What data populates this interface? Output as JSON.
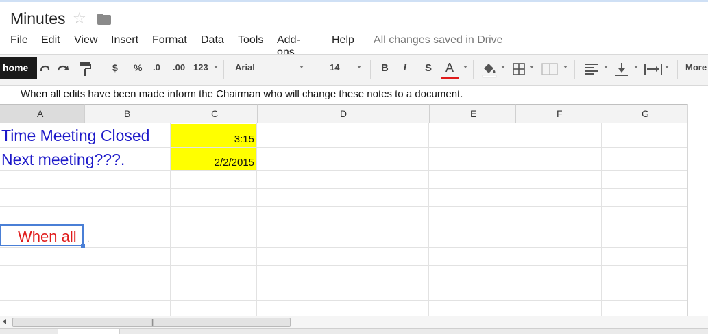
{
  "doc": {
    "title": "Minutes",
    "saved_status": "All changes saved in Drive"
  },
  "menu": [
    "File",
    "Edit",
    "View",
    "Insert",
    "Format",
    "Data",
    "Tools",
    "Add-ons",
    "Help"
  ],
  "toolbar": {
    "home": "home",
    "currency": "$",
    "percent": "%",
    "dec_decrease": ".0",
    "dec_increase": ".00",
    "more_formats": "123",
    "font": "Arial",
    "font_size": "14",
    "bold": "B",
    "italic": "I",
    "strike": "S",
    "text_color": "A",
    "more": "More",
    "text_color_hex": "#e01b1b"
  },
  "formula_bar": {
    "value": "When all edits have been made inform the Chairman who will change these notes to a document."
  },
  "columns": [
    "A",
    "B",
    "C",
    "D",
    "E",
    "F",
    "G"
  ],
  "cells": {
    "a1": "Time Meeting Closed",
    "c1": "3:15",
    "a2": "Next meeting???.",
    "c2": "2/2/2015",
    "a6": "When all",
    "a6_overflow": "."
  },
  "colors": {
    "label_blue": "#1d19c9",
    "highlight_yellow": "#ffff00",
    "selection_blue": "#4a7fd6"
  }
}
